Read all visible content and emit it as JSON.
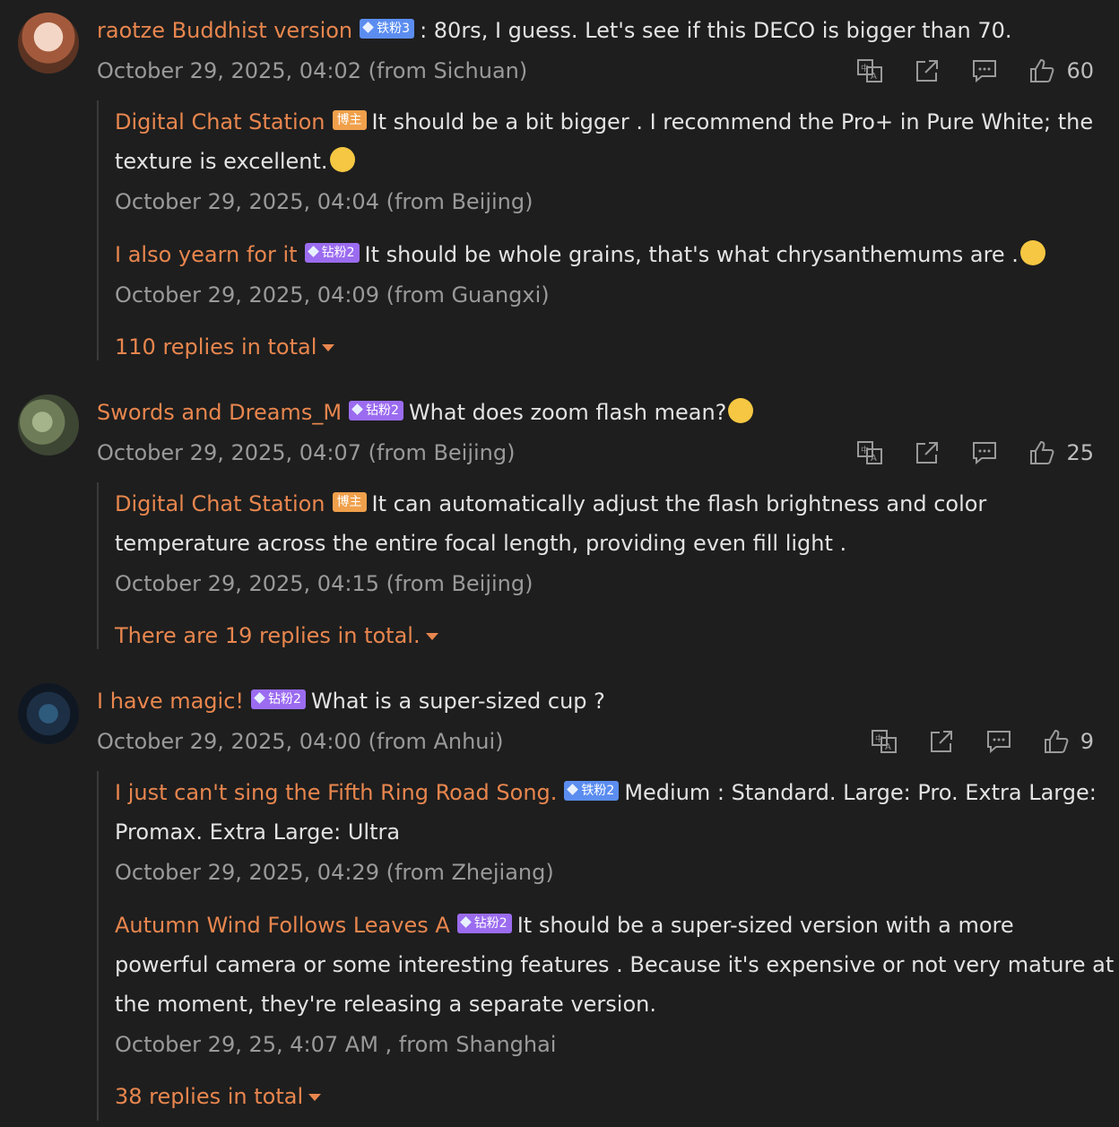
{
  "comments": [
    {
      "user": "raotze Buddhist version",
      "badge": "铁粉3",
      "text": ": 80rs, I guess. Let's see if this DECO is bigger than 70.",
      "meta": "October 29, 2025, 04:02 (from Sichuan)",
      "likes": "60",
      "replies": [
        {
          "user": "Digital Chat Station",
          "badge": "博主",
          "text1": "It should be a bit bigger . I recommend the Pro+ in Pure White; the",
          "text2": "texture is excellent.",
          "meta": "October 29, 2025, 04:04 (from Beijing)"
        },
        {
          "user": "I also yearn for it",
          "badge": "钻粉2",
          "text1": "It should be whole grains, that's what chrysanthemums are .",
          "meta": "October 29, 2025, 04:09 (from Guangxi)"
        }
      ],
      "more": "110 replies in total"
    },
    {
      "user": "Swords and Dreams_M",
      "badge": "钻粉2",
      "text": "What does zoom flash mean?",
      "meta": "October 29, 2025, 04:07 (from Beijing)",
      "likes": "25",
      "replies": [
        {
          "user": "Digital Chat Station",
          "badge": "博主",
          "text1": "It can automatically adjust the flash brightness and color",
          "text2": "temperature across the entire focal length, providing even fill light .",
          "meta": "October 29, 2025, 04:15 (from Beijing)"
        }
      ],
      "more": "There are 19 replies in total."
    },
    {
      "user": "I have magic!",
      "badge": "钻粉2",
      "text": "What is a super-sized cup ?",
      "meta": "October 29, 2025, 04:00 (from Anhui)",
      "likes": "9",
      "replies": [
        {
          "user": "I just can't sing the Fifth Ring Road Song.",
          "badge": "铁粉2",
          "text1": "Medium : Standard. Large: Pro. Extra Large:",
          "text2": "Promax. Extra Large: Ultra",
          "meta": "October 29, 2025, 04:29 (from Zhejiang)"
        },
        {
          "user": "Autumn Wind Follows Leaves A",
          "badge": "钻粉2",
          "text1": "It should be a super-sized version with a more",
          "text2": "powerful camera or some interesting features . Because it's expensive or not very mature at",
          "text3": "the moment, they're releasing a separate version.",
          "meta": "October 29, 25, 4:07 AM , from Shanghai"
        }
      ],
      "more": "38 replies in total"
    }
  ],
  "icons": [
    "translate-icon",
    "share-icon",
    "comment-icon",
    "like-icon"
  ],
  "colors": {
    "background": "#1e1e1e",
    "username": "#e8864e",
    "meta": "#9a9a9a",
    "iron_badge": "#5b8df0",
    "diamond_badge": "#9b6cf0",
    "host_badge": "#f0a04b"
  }
}
